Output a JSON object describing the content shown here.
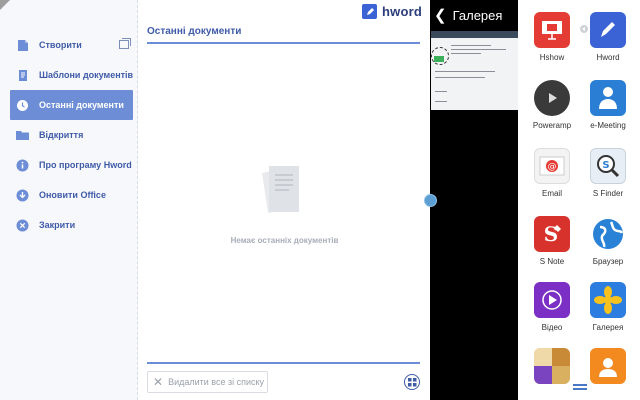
{
  "hword": {
    "logo": "hword",
    "sidebar": [
      {
        "label": "Створити",
        "icon": "document-new-icon"
      },
      {
        "label": "Шаблони документів",
        "icon": "template-icon"
      },
      {
        "label": "Останні документи",
        "icon": "clock-icon",
        "active": true
      },
      {
        "label": "Відкриття",
        "icon": "folder-icon"
      },
      {
        "label": "Про програму Hword",
        "icon": "info-icon"
      },
      {
        "label": "Оновити Office",
        "icon": "download-icon"
      },
      {
        "label": "Закрити",
        "icon": "close-icon"
      }
    ],
    "content_title": "Останні документи",
    "empty_text": "Немає останніх документів",
    "clear_label": "Видалити все зі списку"
  },
  "gallery": {
    "title": "Галерея"
  },
  "drawer": {
    "apps": [
      {
        "label": "Hshow",
        "icon": "hshow-icon"
      },
      {
        "label": "Hword",
        "icon": "hword-icon"
      },
      {
        "label": "Poweramp",
        "icon": "poweramp-icon"
      },
      {
        "label": "e-Meeting",
        "icon": "emeeting-icon"
      },
      {
        "label": "Email",
        "icon": "email-icon"
      },
      {
        "label": "S Finder",
        "icon": "sfinder-icon"
      },
      {
        "label": "S Note",
        "icon": "snote-icon"
      },
      {
        "label": "Браузер",
        "icon": "browser-icon"
      },
      {
        "label": "Відео",
        "icon": "video-icon"
      },
      {
        "label": "Галерея",
        "icon": "gallery-icon"
      },
      {
        "label": "",
        "icon": "partial-app-icon"
      },
      {
        "label": "",
        "icon": "contacts-icon"
      }
    ]
  },
  "colors": {
    "accent": "#6d8ed6",
    "brand": "#3f5ba8",
    "handle": "#5d9fd2"
  }
}
